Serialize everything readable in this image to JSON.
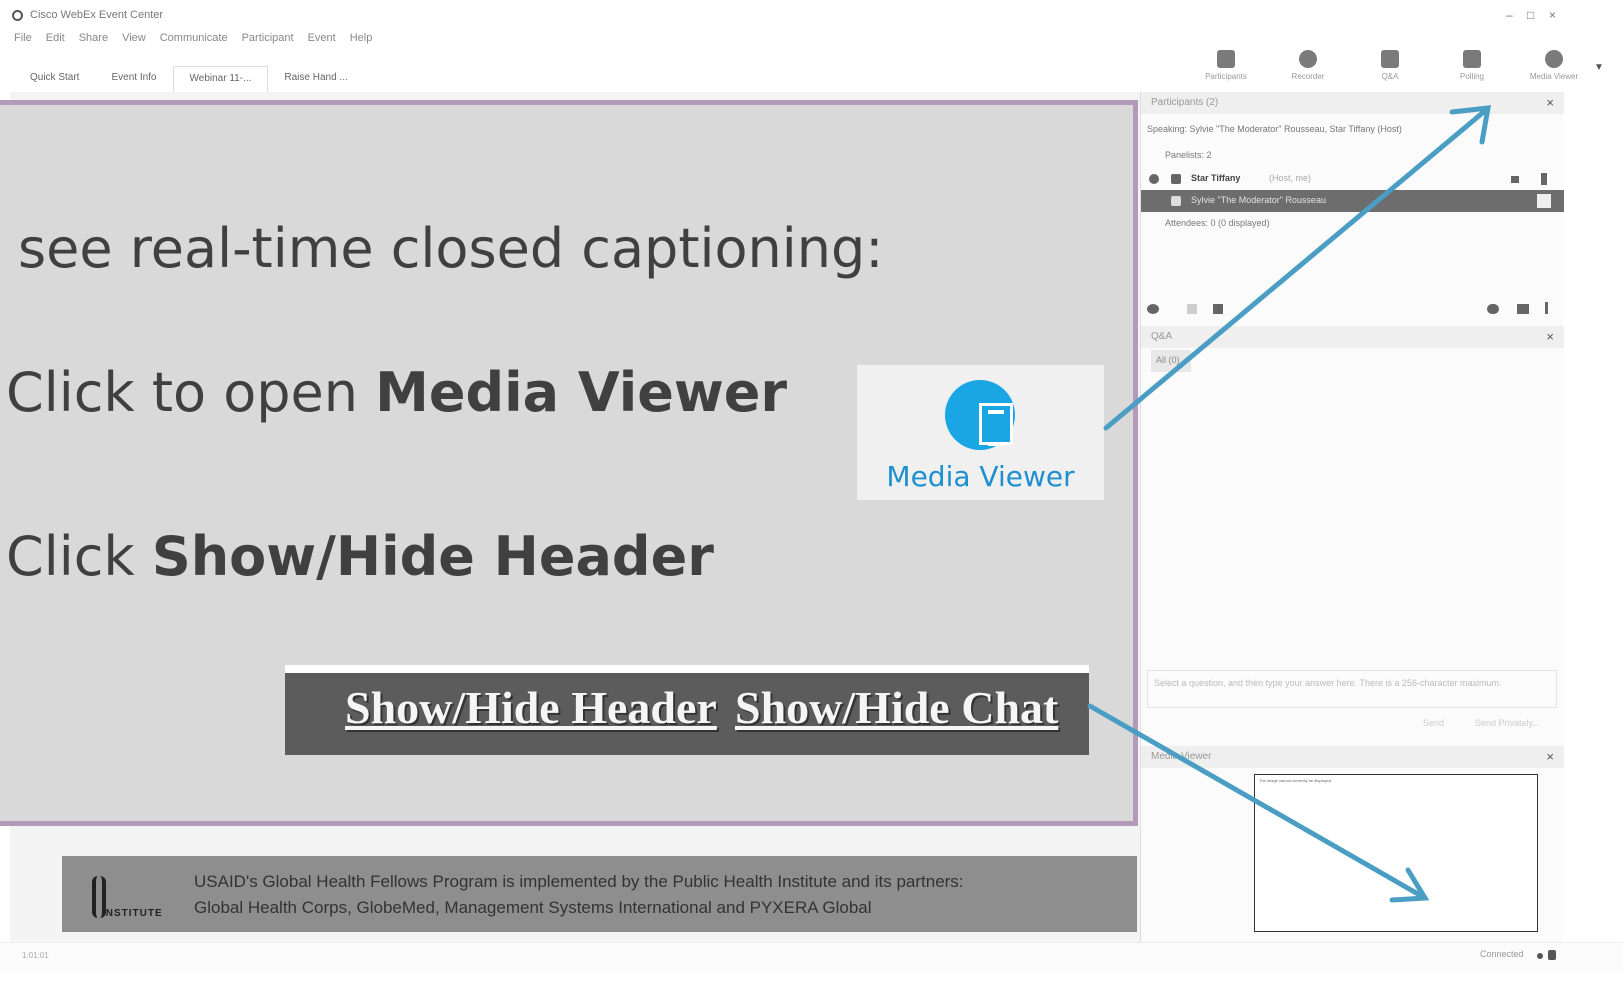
{
  "window": {
    "title": "Cisco WebEx Event Center",
    "controls": [
      "–",
      "□",
      "×"
    ]
  },
  "menu": [
    "File",
    "Edit",
    "Share",
    "View",
    "Communicate",
    "Participant",
    "Event",
    "Help"
  ],
  "tabs": [
    "Quick Start",
    "Event Info",
    "Webinar 11-...",
    "Raise Hand ..."
  ],
  "toolbar": [
    {
      "label": "Participants",
      "icon": "participants-icon"
    },
    {
      "label": "Recorder",
      "icon": "recorder-icon"
    },
    {
      "label": "Q&A",
      "icon": "qa-icon"
    },
    {
      "label": "Polling",
      "icon": "polling-icon"
    },
    {
      "label": "Media Viewer",
      "icon": "media-viewer-icon"
    }
  ],
  "participants_panel": {
    "title": "Participants (2)",
    "speaking": "Speaking: Sylvie \"The Moderator\" Rousseau, Star Tiffany (Host)",
    "panelists_label": "Panelists: 2",
    "panelists": [
      {
        "name": "Star Tiffany",
        "role": "(Host, me)"
      },
      {
        "name": "Sylvie \"The Moderator\" Rousseau",
        "role": ""
      }
    ],
    "attendees_label": "Attendees: 0 (0 displayed)"
  },
  "qa_panel": {
    "title": "Q&A",
    "tab": "All (0)",
    "input_placeholder": "Select a question, and then type your answer here. There is a 256-character maximum.",
    "send": "Send",
    "send_privately": "Send Privately..."
  },
  "media_viewer_panel": {
    "title": "Media Viewer",
    "error": "The image cannot currently be displayed."
  },
  "slide_footer": {
    "line1": "USAID's Global Health Fellows Program is implemented by the Public Health Institute and its partners:",
    "line2": "Global Health Corps, GlobeMed, Management Systems International and PYXERA Global",
    "logo_text": "INSTITUTE"
  },
  "status": {
    "left": "1:01:01",
    "right": "Connected"
  },
  "overlay": {
    "line1": "see real-time closed captioning:",
    "line2_prefix": "Click to open ",
    "line2_bold": "Media Viewer",
    "line3_prefix": "Click ",
    "line3_bold": "Show/Hide Header",
    "media_viewer_label": "Media Viewer",
    "show_hide_header": "Show/Hide Header",
    "show_hide_chat": "Show/Hide Chat",
    "arrow_color": "#4a9ec4",
    "border_color": "#b39ab8"
  }
}
